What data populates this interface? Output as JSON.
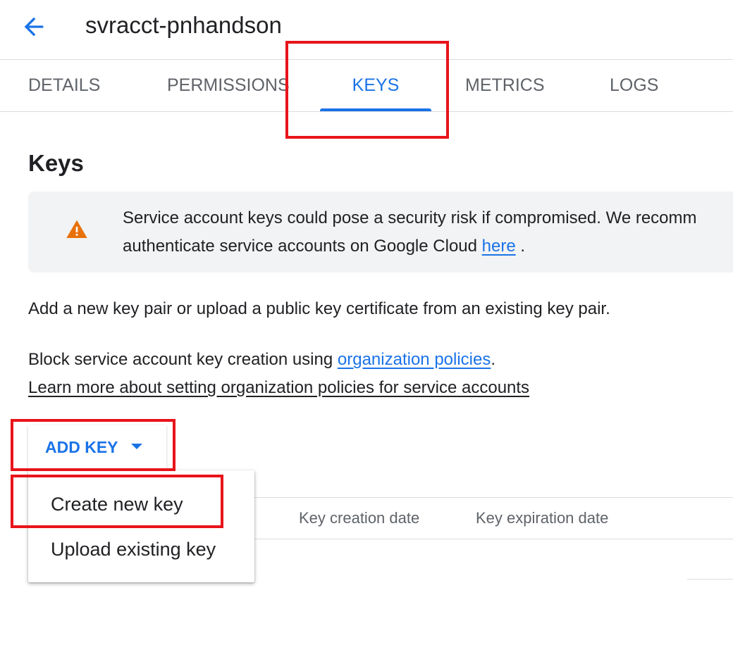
{
  "header": {
    "title": "svracct-pnhandson",
    "back_icon": "arrow-back-icon"
  },
  "tabs": [
    {
      "label": "DETAILS",
      "active": false
    },
    {
      "label": "PERMISSIONS",
      "active": false
    },
    {
      "label": "KEYS",
      "active": true
    },
    {
      "label": "METRICS",
      "active": false
    },
    {
      "label": "LOGS",
      "active": false
    }
  ],
  "keys": {
    "title": "Keys",
    "warning": {
      "icon": "warning-icon",
      "line1": "Service account keys could pose a security risk if compromised. We recomm",
      "line2_prefix": "authenticate service accounts on Google Cloud ",
      "link": "here",
      "line2_suffix": " ."
    },
    "description": "Add a new key pair or upload a public key certificate from an existing key pair.",
    "block_prefix": "Block service account key creation using ",
    "block_link": "organization policies",
    "block_suffix": ".",
    "learn_more": "Learn more about setting organization policies for service accounts",
    "add_key_label": "ADD KEY",
    "menu": [
      "Create new key",
      "Upload existing key"
    ],
    "table": {
      "columns": [
        "Key creation date",
        "Key expiration date"
      ]
    }
  },
  "colors": {
    "accent": "#1a73e8",
    "highlight": "#e8141b",
    "warning": "#e8710a"
  }
}
